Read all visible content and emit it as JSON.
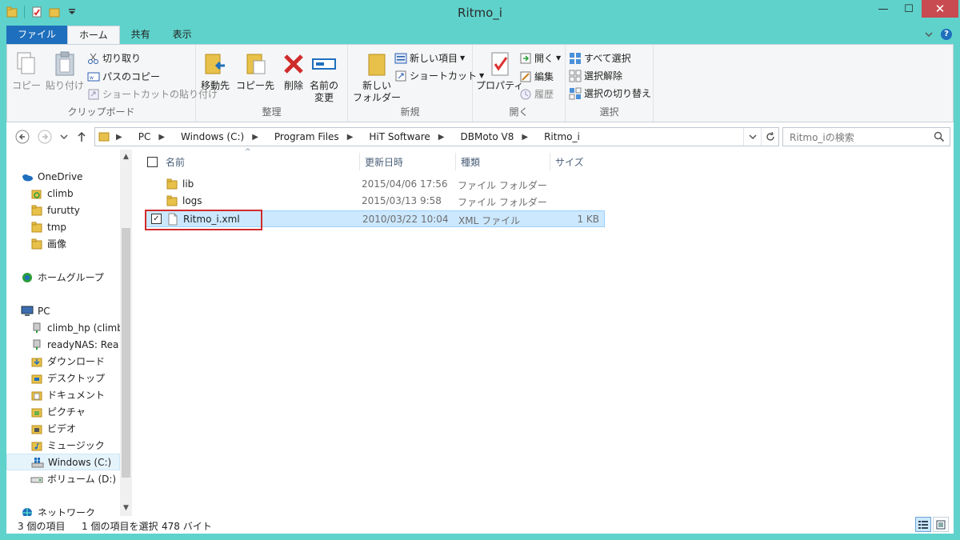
{
  "window": {
    "title": "Ritmo_i",
    "min": "—",
    "max": "☐",
    "close": "✕"
  },
  "ribbon": {
    "tabs": [
      "ファイル",
      "ホーム",
      "共有",
      "表示"
    ],
    "clipboard": {
      "label": "クリップボード",
      "copy": "コピー",
      "paste": "貼り付け",
      "cut": "切り取り",
      "copy_path": "パスのコピー",
      "paste_shortcut": "ショートカットの貼り付け"
    },
    "organize": {
      "label": "整理",
      "move_to": "移動先",
      "copy_to": "コピー先",
      "delete": "削除",
      "rename_line1": "名前の",
      "rename_line2": "変更"
    },
    "new": {
      "label": "新規",
      "new_folder_line1": "新しい",
      "new_folder_line2": "フォルダー",
      "new_item": "新しい項目",
      "shortcut": "ショートカット"
    },
    "open": {
      "label": "開く",
      "properties": "プロパティ",
      "open": "開く",
      "edit": "編集",
      "history": "履歴"
    },
    "select": {
      "label": "選択",
      "select_all": "すべて選択",
      "select_none": "選択解除",
      "invert": "選択の切り替え"
    }
  },
  "address": {
    "crumbs": [
      "PC",
      "Windows (C:)",
      "Program Files",
      "HiT Software",
      "DBMoto V8",
      "Ritmo_i"
    ],
    "search_placeholder": "Ritmo_iの検索"
  },
  "navpane": {
    "items": [
      {
        "label": "OneDrive",
        "icon": "onedrive-icon"
      },
      {
        "label": "climb",
        "icon": "sync-folder-icon"
      },
      {
        "label": "furutty",
        "icon": "folder-icon"
      },
      {
        "label": "tmp",
        "icon": "folder-icon"
      },
      {
        "label": "画像",
        "icon": "folder-icon"
      },
      {
        "label": "ホームグループ",
        "icon": "homegroup-icon"
      },
      {
        "label": "PC",
        "icon": "pc-icon"
      },
      {
        "label": "climb_hp (climb",
        "icon": "network-drive-icon"
      },
      {
        "label": "readyNAS: Rea",
        "icon": "network-drive-icon"
      },
      {
        "label": "ダウンロード",
        "icon": "downloads-folder-icon"
      },
      {
        "label": "デスクトップ",
        "icon": "desktop-folder-icon"
      },
      {
        "label": "ドキュメント",
        "icon": "documents-folder-icon"
      },
      {
        "label": "ピクチャ",
        "icon": "pictures-folder-icon"
      },
      {
        "label": "ビデオ",
        "icon": "videos-folder-icon"
      },
      {
        "label": "ミュージック",
        "icon": "music-folder-icon"
      },
      {
        "label": "Windows (C:)",
        "icon": "system-drive-icon"
      },
      {
        "label": "ボリューム (D:)",
        "icon": "drive-icon"
      },
      {
        "label": "ネットワーク",
        "icon": "network-icon"
      }
    ]
  },
  "files": {
    "columns": [
      "名前",
      "更新日時",
      "種類",
      "サイズ"
    ],
    "rows": [
      {
        "name": "lib",
        "date": "2015/04/06 17:56",
        "type": "ファイル フォルダー",
        "size": ""
      },
      {
        "name": "logs",
        "date": "2015/03/13 9:58",
        "type": "ファイル フォルダー",
        "size": ""
      },
      {
        "name": "Ritmo_i.xml",
        "date": "2010/03/22 10:04",
        "type": "XML ファイル",
        "size": "1 KB"
      }
    ]
  },
  "status": {
    "count": "3 個の項目",
    "selected": "1 個の項目を選択",
    "size": "478 バイト"
  },
  "colors": {
    "frame": "#5fd2cb",
    "file_tab": "#1e6fbd",
    "selection": "#cce8ff",
    "highlight_box": "#d22b2b"
  }
}
